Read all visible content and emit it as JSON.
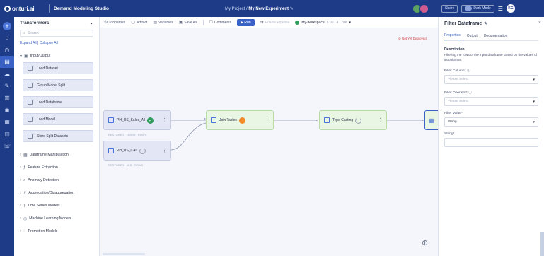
{
  "app": {
    "logo": "onturi.ai",
    "studio": "Demand Modeling Studio",
    "breadcrumb_project": "My Project",
    "breadcrumb_separator": "/",
    "breadcrumb_experiment": "My New Experiment",
    "share_label": "Share",
    "dark_mode_label": "Dark Mode",
    "user_initials": "KG"
  },
  "colors": {
    "brand": "#1d3b86",
    "accent": "#3a62c6",
    "success": "#2e9d5b",
    "warning": "#f08a2b",
    "dataset_node": "#e3e6f4",
    "transform_node": "#eaf6e4"
  },
  "transformers": {
    "title": "Transformers",
    "search_placeholder": "Search",
    "expand_all": "Expand All",
    "collapse_all": "Collapse All",
    "link_sep": "|",
    "io_category": "Input/Output",
    "io_items": [
      {
        "label": "Load Dataset"
      },
      {
        "label": "Group Model Split"
      },
      {
        "label": "Load Dataframe"
      },
      {
        "label": "Load Model"
      },
      {
        "label": "Store Split Datasets"
      }
    ],
    "categories": [
      {
        "label": "Dataframe Manipulation"
      },
      {
        "label": "Feature Extraction"
      },
      {
        "label": "Anomaly Detection"
      },
      {
        "label": "Aggregation/Disaggregation"
      },
      {
        "label": "Time Series Models"
      },
      {
        "label": "Machine Learning Models"
      },
      {
        "label": "Promotion Models"
      }
    ]
  },
  "toolbar": {
    "properties": "Properties",
    "artifact": "Artifact",
    "variables": "Variables",
    "save_as": "Save As",
    "comments": "Comments",
    "run": "Run",
    "enable_pipeline": "Enable Pipeline",
    "environment": "My-workspace",
    "environment_detail": "8.00 / 4 Core"
  },
  "canvas": {
    "warning": "Not Yet Deployed",
    "nodes": [
      {
        "label": "PH_US_Sales_All",
        "sub": "RESTORED · 150MB · ROWS",
        "status": "success"
      },
      {
        "label": "PH_US_CAL",
        "sub": "RESTORED · 8KB · ROWS",
        "status": "pending"
      },
      {
        "label": "Join Tables",
        "status": "warning"
      },
      {
        "label": "Type Casting",
        "status": "pending"
      }
    ]
  },
  "properties": {
    "title": "Filter Dataframe",
    "tabs": [
      "Properties",
      "Output",
      "Documentation"
    ],
    "active_tab": "Properties",
    "description_heading": "Description",
    "description": "Filtering the rows of the input dataframe based on the values of its columns.",
    "filter_column_label": "Filter Column*",
    "filter_column_placeholder": "Please Select",
    "filter_operator_label": "Filter Operator*",
    "filter_operator_placeholder": "Please Select",
    "filter_value_label": "Filter Value*",
    "filter_value": "String",
    "string_label": "String*",
    "string_value": ""
  }
}
